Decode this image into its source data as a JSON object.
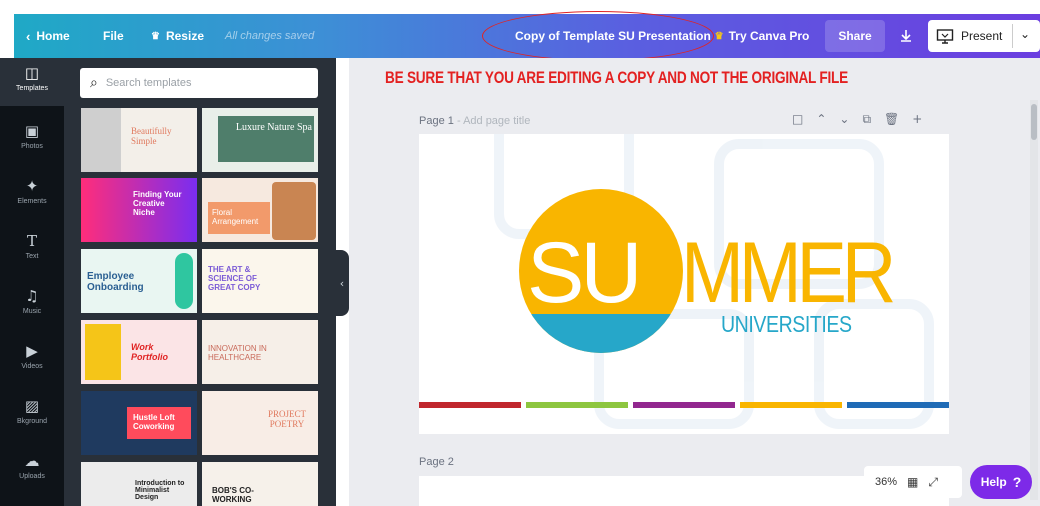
{
  "topbar": {
    "home_label": "Home",
    "file_label": "File",
    "resize_label": "Resize",
    "saved_status": "All changes saved",
    "doc_title": "Copy of Template SU Presentation",
    "try_pro_label": "Try Canva Pro",
    "share_label": "Share",
    "present_label": "Present",
    "accent_color": "#7d2ae8"
  },
  "annotation": "BE SURE THAT YOU ARE EDITING A COPY AND NOT THE ORIGINAL FILE",
  "rail": [
    {
      "icon": "templates-icon",
      "label": "Templates"
    },
    {
      "icon": "photos-icon",
      "label": "Photos"
    },
    {
      "icon": "elements-icon",
      "label": "Elements"
    },
    {
      "icon": "text-icon",
      "label": "Text"
    },
    {
      "icon": "music-icon",
      "label": "Music"
    },
    {
      "icon": "videos-icon",
      "label": "Videos"
    },
    {
      "icon": "background-icon",
      "label": "Bkground"
    },
    {
      "icon": "uploads-icon",
      "label": "Uploads"
    }
  ],
  "search": {
    "placeholder": "Search templates"
  },
  "templates": [
    {
      "title": "Beautifully Simple"
    },
    {
      "title": "Luxure Nature Spa"
    },
    {
      "title": "Finding Your Creative Niche"
    },
    {
      "title": "Floral Arrangement"
    },
    {
      "title": "Employee Onboarding"
    },
    {
      "title": "THE ART & SCIENCE OF GREAT COPY"
    },
    {
      "title": "Work Portfolio"
    },
    {
      "title": "INNOVATION IN HEALTHCARE"
    },
    {
      "title": "Hustle Loft Coworking"
    },
    {
      "title": "PROJECT POETRY"
    },
    {
      "title": "Introduction to Minimalist Design"
    },
    {
      "title": "BOB'S CO-WORKING"
    }
  ],
  "pages": {
    "page1_label": "Page 1",
    "page1_title_placeholder": "Add page title",
    "page2_label": "Page 2"
  },
  "slide": {
    "word_1": "SU",
    "word_2": "MMER",
    "subtitle": "UNIVERSITIES",
    "yellow": "#f9b500",
    "blue": "#26a7c9",
    "stripes": [
      "#c0272d",
      "#8dc63f",
      "#92278f",
      "#f9b500",
      "#1f6bb6"
    ]
  },
  "footer": {
    "zoom": "36%",
    "help_label": "Help",
    "help_symbol": "?"
  }
}
